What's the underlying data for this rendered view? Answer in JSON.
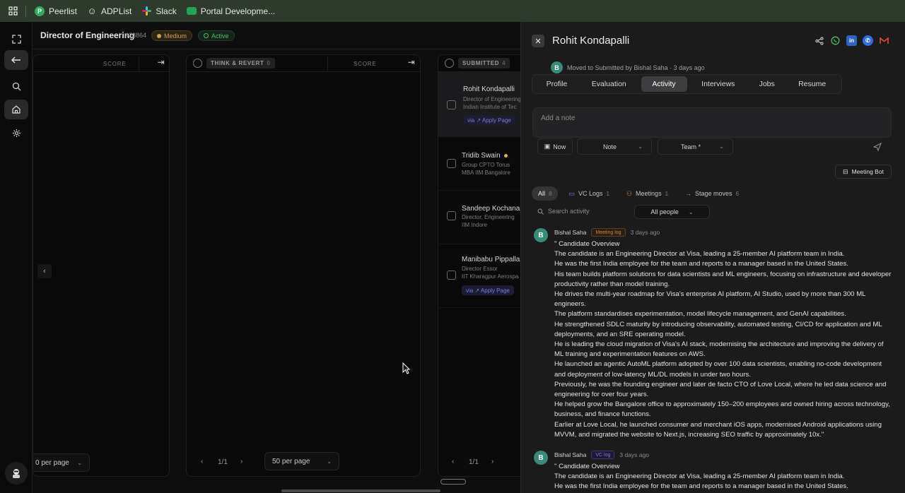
{
  "bookmarks": [
    {
      "label": "Peerlist",
      "icon": "peerlist-icon",
      "color": "#2eae5e",
      "glyph": "P"
    },
    {
      "label": "ADPList",
      "icon": "adplist-icon",
      "color": "#2d3a2c",
      "glyph": "☺"
    },
    {
      "label": "Slack",
      "icon": "slack-icon",
      "color": "#2d3a2c",
      "glyph": "✱"
    },
    {
      "label": "Portal Developme...",
      "icon": "portal-icon",
      "color": "#27a155",
      "glyph": "▬"
    }
  ],
  "job": {
    "title": "Director of Engineering",
    "id": "#23864",
    "priority": "Medium",
    "status": "Active"
  },
  "columns": {
    "left": {
      "score_label": "SCORE",
      "per_page": "0 per page"
    },
    "middle": {
      "stage": "THINK & REVERT",
      "count": "0",
      "score_label": "SCORE",
      "page": "1/1",
      "per_page": "50 per page"
    },
    "right": {
      "stage": "SUBMITTED",
      "count": "4",
      "page": "1/1"
    }
  },
  "candidates": [
    {
      "name": "Rohit Kondapalli",
      "line1": "Director of Engineering",
      "line2": "Indian Institute of Tec",
      "via": "via ↗ Apply Page"
    },
    {
      "name": "Tridib Swain",
      "line1": "Group CPTO Torus",
      "line2": "MBA IIM Bangalore"
    },
    {
      "name": "Sandeep Kochana",
      "line1": "Director, Engineering",
      "line2": "IIM Indore"
    },
    {
      "name": "Manibabu Pippalla",
      "line1": "Director Essor",
      "line2": "IIT Kharagpur Aerospa",
      "via": "via ↗ Apply Page"
    }
  ],
  "drawer": {
    "name": "Rohit Kondapalli",
    "moved_text": "Moved to Submitted by Bishal Saha · 3 days ago",
    "avatar_initial": "B",
    "tabs": [
      "Profile",
      "Evaluation",
      "Activity",
      "Interviews",
      "Jobs",
      "Resume"
    ],
    "active_tab": "Activity",
    "note_placeholder": "Add a note",
    "now_label": "Now",
    "note_type": "Note",
    "visibility": "Team *",
    "meeting_bot": "Meeting Bot",
    "filters": [
      {
        "label": "All",
        "count": "8"
      },
      {
        "label": "VC Logs",
        "count": "1"
      },
      {
        "label": "Meetings",
        "count": "1"
      },
      {
        "label": "Stage moves",
        "count": "6"
      }
    ],
    "search_placeholder": "Search activity",
    "people_filter": "All people",
    "entries": [
      {
        "author": "Bishal Saha",
        "tag": "Meeting log",
        "time": "3 days ago",
        "lines": [
          "\" Candidate Overview",
          "The candidate is an Engineering Director at Visa, leading a 25-member AI platform team in India.",
          "He was the first India employee for the team and reports to a manager based in the United States.",
          "His team builds platform solutions for data scientists and ML engineers, focusing on infrastructure and developer productivity rather than model training.",
          "He drives the multi-year roadmap for Visa's enterprise AI platform, AI Studio, used by more than 300 ML engineers.",
          "The platform standardises experimentation, model lifecycle management, and GenAI capabilities.",
          "He strengthened SDLC maturity by introducing observability, automated testing, CI/CD for application and ML deployments, and an SRE operating model.",
          "He is leading the cloud migration of Visa's AI stack, modernising the architecture and improving the delivery of ML training and experimentation features on AWS.",
          "He launched an agentic AutoML platform adopted by over 100 data scientists, enabling no-code development and deployment of low-latency ML/DL models in under two hours.",
          "Previously, he was the founding engineer and later de facto CTO of Love Local, where he led data science and engineering for over four years.",
          "He helped grow the Bangalore office to approximately 150–200 employees and owned hiring across technology, business, and finance functions.",
          "Earlier at Love Local, he launched consumer and merchant iOS apps, modernised Android applications using MVVM, and migrated the website to Next.js, increasing SEO traffic by approximately 10x.\""
        ]
      },
      {
        "author": "Bishal Saha",
        "tag": "VC log",
        "time": "3 days ago",
        "lines": [
          "\" Candidate Overview",
          "The candidate is an Engineering Director at Visa, leading a 25-member AI platform team in India.",
          "He was the first India employee for the team and reports to a manager based in the United States."
        ]
      }
    ]
  },
  "colors": {
    "bookmark_bar": "#2d3a2c",
    "drawer_bg": "#1b1b1c",
    "accent_green": "#3a8a7a",
    "tag_orange": "#c98a3a",
    "tag_purple": "#8a7bdc"
  }
}
